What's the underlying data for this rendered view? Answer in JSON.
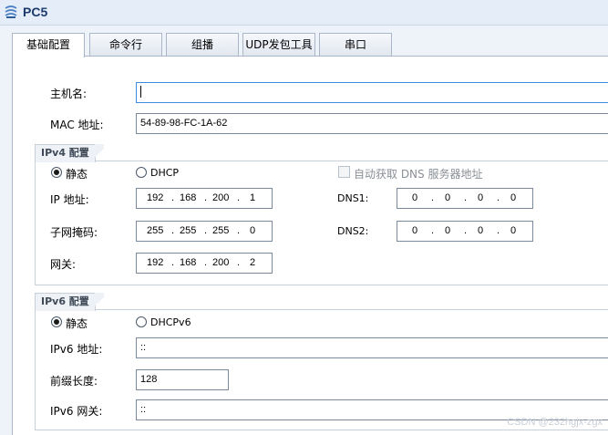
{
  "window": {
    "title": "PC5",
    "icon": "network-pc-icon"
  },
  "tabs": [
    {
      "label": "基础配置",
      "active": true
    },
    {
      "label": "命令行",
      "active": false
    },
    {
      "label": "组播",
      "active": false
    },
    {
      "label": "UDP发包工具",
      "active": false
    },
    {
      "label": "串口",
      "active": false
    }
  ],
  "basic": {
    "hostname_label": "主机名:",
    "hostname_value": "",
    "mac_label": "MAC 地址:",
    "mac_value": "54-89-98-FC-1A-62"
  },
  "ipv4": {
    "group_title": "IPv4 配置",
    "static_label": "静态",
    "dhcp_label": "DHCP",
    "mode": "static",
    "auto_dns_label": "自动获取 DNS 服务器地址",
    "auto_dns_checked": false,
    "ip_label": "IP 地址:",
    "ip": [
      "192",
      "168",
      "200",
      "1"
    ],
    "mask_label": "子网掩码:",
    "mask": [
      "255",
      "255",
      "255",
      "0"
    ],
    "gateway_label": "网关:",
    "gateway": [
      "192",
      "168",
      "200",
      "2"
    ],
    "dns1_label": "DNS1:",
    "dns1": [
      "0",
      "0",
      "0",
      "0"
    ],
    "dns2_label": "DNS2:",
    "dns2": [
      "0",
      "0",
      "0",
      "0"
    ]
  },
  "ipv6": {
    "group_title": "IPv6 配置",
    "static_label": "静态",
    "dhcp_label": "DHCPv6",
    "mode": "static",
    "addr_label": "IPv6 地址:",
    "addr_value": "::",
    "prefix_label": "前缀长度:",
    "prefix_value": "128",
    "gateway_label": "IPv6 网关:",
    "gateway_value": "::"
  },
  "watermark": "CSDN @232hgjx-zgx"
}
